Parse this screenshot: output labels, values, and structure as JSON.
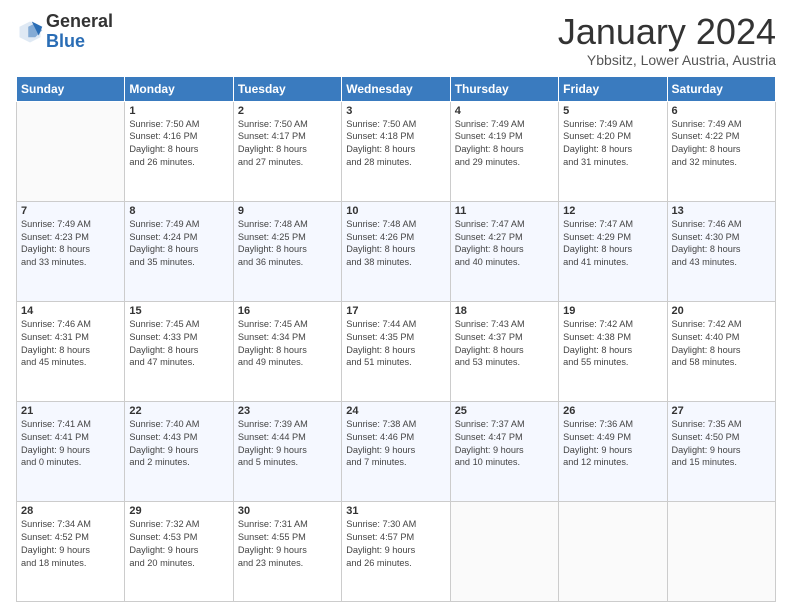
{
  "logo": {
    "general": "General",
    "blue": "Blue"
  },
  "title": "January 2024",
  "subtitle": "Ybbsitz, Lower Austria, Austria",
  "weekdays": [
    "Sunday",
    "Monday",
    "Tuesday",
    "Wednesday",
    "Thursday",
    "Friday",
    "Saturday"
  ],
  "weeks": [
    [
      {
        "day": "",
        "content": ""
      },
      {
        "day": "1",
        "content": "Sunrise: 7:50 AM\nSunset: 4:16 PM\nDaylight: 8 hours\nand 26 minutes."
      },
      {
        "day": "2",
        "content": "Sunrise: 7:50 AM\nSunset: 4:17 PM\nDaylight: 8 hours\nand 27 minutes."
      },
      {
        "day": "3",
        "content": "Sunrise: 7:50 AM\nSunset: 4:18 PM\nDaylight: 8 hours\nand 28 minutes."
      },
      {
        "day": "4",
        "content": "Sunrise: 7:49 AM\nSunset: 4:19 PM\nDaylight: 8 hours\nand 29 minutes."
      },
      {
        "day": "5",
        "content": "Sunrise: 7:49 AM\nSunset: 4:20 PM\nDaylight: 8 hours\nand 31 minutes."
      },
      {
        "day": "6",
        "content": "Sunrise: 7:49 AM\nSunset: 4:22 PM\nDaylight: 8 hours\nand 32 minutes."
      }
    ],
    [
      {
        "day": "7",
        "content": "Sunrise: 7:49 AM\nSunset: 4:23 PM\nDaylight: 8 hours\nand 33 minutes."
      },
      {
        "day": "8",
        "content": "Sunrise: 7:49 AM\nSunset: 4:24 PM\nDaylight: 8 hours\nand 35 minutes."
      },
      {
        "day": "9",
        "content": "Sunrise: 7:48 AM\nSunset: 4:25 PM\nDaylight: 8 hours\nand 36 minutes."
      },
      {
        "day": "10",
        "content": "Sunrise: 7:48 AM\nSunset: 4:26 PM\nDaylight: 8 hours\nand 38 minutes."
      },
      {
        "day": "11",
        "content": "Sunrise: 7:47 AM\nSunset: 4:27 PM\nDaylight: 8 hours\nand 40 minutes."
      },
      {
        "day": "12",
        "content": "Sunrise: 7:47 AM\nSunset: 4:29 PM\nDaylight: 8 hours\nand 41 minutes."
      },
      {
        "day": "13",
        "content": "Sunrise: 7:46 AM\nSunset: 4:30 PM\nDaylight: 8 hours\nand 43 minutes."
      }
    ],
    [
      {
        "day": "14",
        "content": "Sunrise: 7:46 AM\nSunset: 4:31 PM\nDaylight: 8 hours\nand 45 minutes."
      },
      {
        "day": "15",
        "content": "Sunrise: 7:45 AM\nSunset: 4:33 PM\nDaylight: 8 hours\nand 47 minutes."
      },
      {
        "day": "16",
        "content": "Sunrise: 7:45 AM\nSunset: 4:34 PM\nDaylight: 8 hours\nand 49 minutes."
      },
      {
        "day": "17",
        "content": "Sunrise: 7:44 AM\nSunset: 4:35 PM\nDaylight: 8 hours\nand 51 minutes."
      },
      {
        "day": "18",
        "content": "Sunrise: 7:43 AM\nSunset: 4:37 PM\nDaylight: 8 hours\nand 53 minutes."
      },
      {
        "day": "19",
        "content": "Sunrise: 7:42 AM\nSunset: 4:38 PM\nDaylight: 8 hours\nand 55 minutes."
      },
      {
        "day": "20",
        "content": "Sunrise: 7:42 AM\nSunset: 4:40 PM\nDaylight: 8 hours\nand 58 minutes."
      }
    ],
    [
      {
        "day": "21",
        "content": "Sunrise: 7:41 AM\nSunset: 4:41 PM\nDaylight: 9 hours\nand 0 minutes."
      },
      {
        "day": "22",
        "content": "Sunrise: 7:40 AM\nSunset: 4:43 PM\nDaylight: 9 hours\nand 2 minutes."
      },
      {
        "day": "23",
        "content": "Sunrise: 7:39 AM\nSunset: 4:44 PM\nDaylight: 9 hours\nand 5 minutes."
      },
      {
        "day": "24",
        "content": "Sunrise: 7:38 AM\nSunset: 4:46 PM\nDaylight: 9 hours\nand 7 minutes."
      },
      {
        "day": "25",
        "content": "Sunrise: 7:37 AM\nSunset: 4:47 PM\nDaylight: 9 hours\nand 10 minutes."
      },
      {
        "day": "26",
        "content": "Sunrise: 7:36 AM\nSunset: 4:49 PM\nDaylight: 9 hours\nand 12 minutes."
      },
      {
        "day": "27",
        "content": "Sunrise: 7:35 AM\nSunset: 4:50 PM\nDaylight: 9 hours\nand 15 minutes."
      }
    ],
    [
      {
        "day": "28",
        "content": "Sunrise: 7:34 AM\nSunset: 4:52 PM\nDaylight: 9 hours\nand 18 minutes."
      },
      {
        "day": "29",
        "content": "Sunrise: 7:32 AM\nSunset: 4:53 PM\nDaylight: 9 hours\nand 20 minutes."
      },
      {
        "day": "30",
        "content": "Sunrise: 7:31 AM\nSunset: 4:55 PM\nDaylight: 9 hours\nand 23 minutes."
      },
      {
        "day": "31",
        "content": "Sunrise: 7:30 AM\nSunset: 4:57 PM\nDaylight: 9 hours\nand 26 minutes."
      },
      {
        "day": "",
        "content": ""
      },
      {
        "day": "",
        "content": ""
      },
      {
        "day": "",
        "content": ""
      }
    ]
  ]
}
